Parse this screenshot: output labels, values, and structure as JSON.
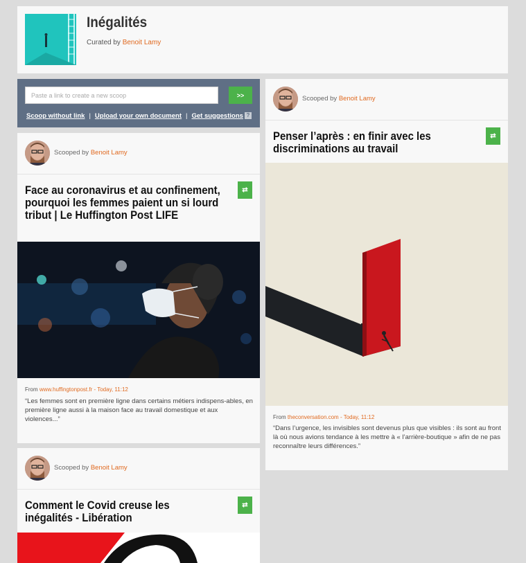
{
  "topic": {
    "title": "Inégalités",
    "curated_prefix": "Curated by",
    "curator": "Benoit Lamy"
  },
  "scoop_form": {
    "placeholder": "Paste a link to create a new scoop",
    "go_label": ">>",
    "links": [
      "Scoop without link",
      "Upload your own document",
      "Get suggestions"
    ],
    "separator": "|",
    "help_label": "?"
  },
  "posts": [
    {
      "scooped_prefix": "Scooped by",
      "author": "Benoit Lamy",
      "title": "Face au coronavirus et au confinement, pourquoi les femmes paient un si lourd tribut | Le Huffington Post LIFE",
      "source_prefix": "From",
      "source_domain": "www.huffingtonpost.fr",
      "source_time": " - Today, 11:12",
      "excerpt": "“Les femmes sont en première ligne dans certains métiers indispens-ables, en première ligne aussi à la maison face au travail domestique et aux violences...”"
    },
    {
      "scooped_prefix": "Scooped by",
      "author": "Benoit Lamy",
      "title": "Penser l’après : en finir avec les discriminations au travail",
      "source_prefix": "From",
      "source_domain": "theconversation.com",
      "source_time": " - Today, 11:12",
      "excerpt": "“Dans l’urgence, les invisibles sont devenus plus que visibles : ils sont au front là où nous avions tendance à les mettre à « l’arrière-boutique » afin de ne pas reconnaître leurs différences.”"
    },
    {
      "scooped_prefix": "Scooped by",
      "author": "Benoit Lamy",
      "title": "Comment le Covid creuse les inégalités - Libération"
    }
  ],
  "colors": {
    "accent": "#e0691f",
    "rescoop": "#4cb24a",
    "form_bg": "#5f6f85",
    "page_bg": "#dcdcdc"
  },
  "icons": {
    "rescoop": "rescoop-icon",
    "help": "help-icon"
  }
}
